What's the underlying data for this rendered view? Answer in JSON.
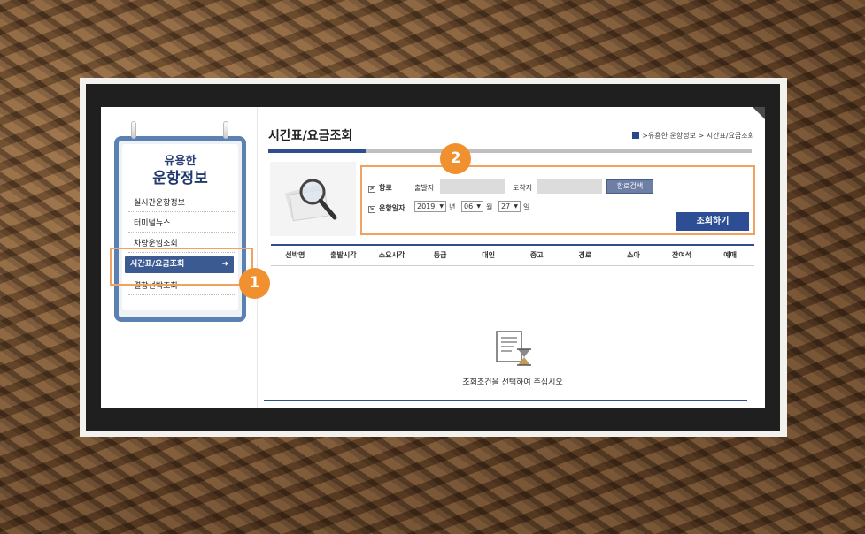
{
  "sidebar": {
    "title_line1": "유용한",
    "title_line2": "운항정보",
    "items": [
      {
        "label": "실시간운항정보"
      },
      {
        "label": "터미널뉴스"
      },
      {
        "label": "차량운임조회"
      },
      {
        "label": "시간표/요금조회"
      },
      {
        "label": "결항선박조회"
      }
    ]
  },
  "page": {
    "title": "시간표/요금조회",
    "breadcrumb": ">유용한 운항정보 > 시간표/요금조회"
  },
  "search": {
    "route_label": "항로",
    "departure_label": "출발지",
    "arrival_label": "도착지",
    "route_search_button": "항로검색",
    "date_label": "운항일자",
    "year": "2019",
    "year_unit": "년",
    "month": "06",
    "month_unit": "월",
    "day": "27",
    "day_unit": "일",
    "query_button": "조회하기"
  },
  "table": {
    "headers": [
      "선박명",
      "출발시각",
      "소요시각",
      "등급",
      "대인",
      "중고",
      "경로",
      "소아",
      "잔여석",
      "예매"
    ]
  },
  "empty_message": "조회조건을 선택하여 주십시오",
  "badges": {
    "one": "1",
    "two": "2"
  },
  "colors": {
    "accent": "#f0902f",
    "primary": "#2d4e95"
  }
}
